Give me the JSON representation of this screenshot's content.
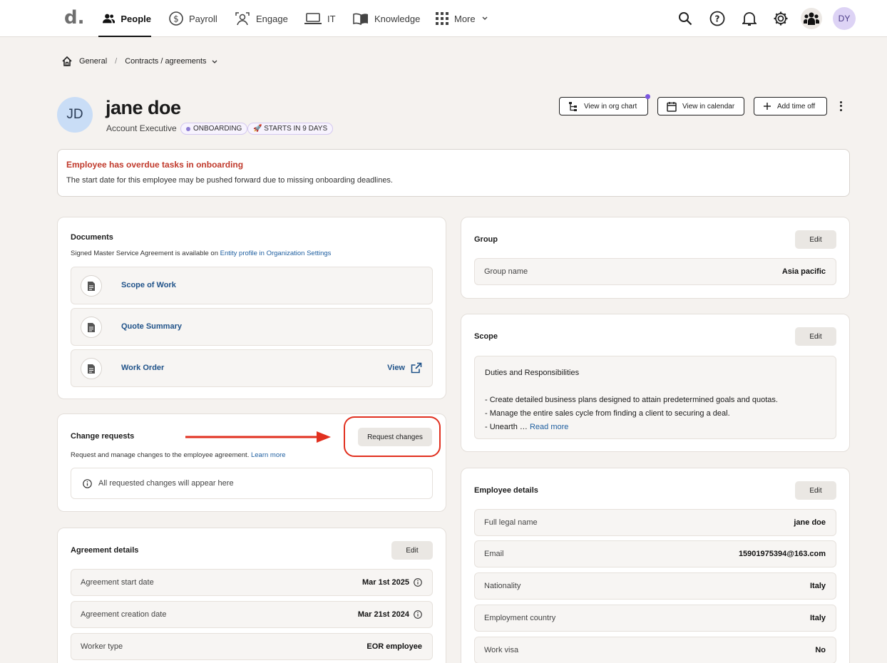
{
  "nav": {
    "logo": "d.",
    "items": [
      {
        "label": "People",
        "icon": "people-icon"
      },
      {
        "label": "Payroll",
        "icon": "dollar-icon"
      },
      {
        "label": "Engage",
        "icon": "engage-icon"
      },
      {
        "label": "IT",
        "icon": "laptop-icon"
      },
      {
        "label": "Knowledge",
        "icon": "book-icon"
      },
      {
        "label": "More",
        "icon": "grid-icon"
      }
    ],
    "user_initials": "DY"
  },
  "breadcrumb": {
    "home": "General",
    "current": "Contracts / agreements"
  },
  "employee": {
    "initials": "JD",
    "name": "jane doe",
    "role": "Account Executive",
    "status_badge": "ONBOARDING",
    "start_badge": "🚀 STARTS IN 9 DAYS"
  },
  "actions": {
    "org_chart": "View in org chart",
    "calendar": "View in calendar",
    "time_off": "Add time off"
  },
  "alert": {
    "title": "Employee has overdue tasks in onboarding",
    "message": "The start date for this employee may be pushed forward due to missing onboarding deadlines."
  },
  "documents": {
    "title": "Documents",
    "subtitle_prefix": "Signed Master Service Agreement is available on ",
    "subtitle_link": "Entity profile in Organization Settings",
    "items": [
      {
        "label": "Scope of Work"
      },
      {
        "label": "Quote Summary"
      },
      {
        "label": "Work Order",
        "action": "View"
      }
    ]
  },
  "change_requests": {
    "title": "Change requests",
    "subtitle": "Request and manage changes to the employee agreement. ",
    "learn_more": "Learn more",
    "button": "Request changes",
    "empty": "All requested changes will appear here"
  },
  "agreement": {
    "title": "Agreement details",
    "edit": "Edit",
    "rows": [
      {
        "label": "Agreement start date",
        "value": "Mar 1st 2025"
      },
      {
        "label": "Agreement creation date",
        "value": "Mar 21st 2024"
      },
      {
        "label": "Worker type",
        "value": "EOR employee"
      }
    ]
  },
  "group": {
    "title": "Group",
    "edit": "Edit",
    "label": "Group name",
    "value": "Asia pacific"
  },
  "scope": {
    "title": "Scope",
    "edit": "Edit",
    "heading": "Duties and Responsibilities",
    "line1": "- Create detailed business plans designed to attain predetermined goals and quotas.",
    "line2": "- Manage the entire sales cycle from finding a client to securing a deal.",
    "line3": "- Unearth … ",
    "read_more": "Read more"
  },
  "employee_details": {
    "title": "Employee details",
    "edit": "Edit",
    "rows": [
      {
        "label": "Full legal name",
        "value": "jane doe"
      },
      {
        "label": "Email",
        "value": "15901975394@163.com"
      },
      {
        "label": "Nationality",
        "value": "Italy"
      },
      {
        "label": "Employment country",
        "value": "Italy"
      },
      {
        "label": "Work visa",
        "value": "No"
      }
    ]
  },
  "colors": {
    "accent_red": "#e1301f",
    "link_blue": "#1f5289",
    "alert_red": "#c0392b",
    "badge_purple": "#8d7cd3"
  }
}
